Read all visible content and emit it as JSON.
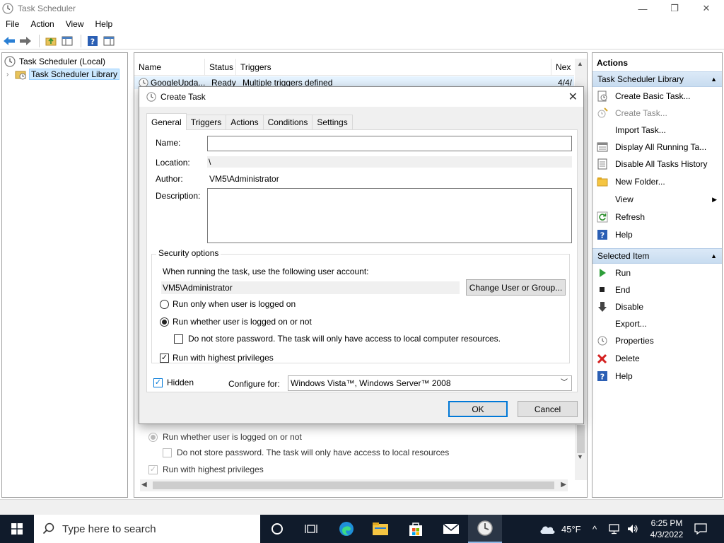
{
  "window": {
    "title": "Task Scheduler",
    "minimize": "—",
    "maximize": "❐",
    "close": "✕"
  },
  "menu": [
    "File",
    "Action",
    "View",
    "Help"
  ],
  "tree": {
    "root": "Task Scheduler (Local)",
    "library": "Task Scheduler Library"
  },
  "list": {
    "columns": [
      "Name",
      "Status",
      "Triggers",
      "Nex"
    ],
    "rows": [
      {
        "name": "GoogleUpda...",
        "status": "Ready",
        "triggers": "Multiple triggers defined",
        "next": "4/4/"
      }
    ]
  },
  "background_props": {
    "run_whether": "Run whether user is logged on or not",
    "no_store": "Do not store password.  The task will only have access to local resources",
    "highest": "Run with highest privileges"
  },
  "actions": {
    "header": "Actions",
    "group1": "Task Scheduler Library",
    "items1": [
      {
        "label": "Create Basic Task...",
        "icon": "create-basic-task-icon"
      },
      {
        "label": "Create Task...",
        "icon": "create-task-icon",
        "disabled": true
      },
      {
        "label": "Import Task...",
        "icon": ""
      },
      {
        "label": "Display All Running Ta...",
        "icon": "running-tasks-icon"
      },
      {
        "label": "Disable All Tasks History",
        "icon": "history-icon"
      },
      {
        "label": "New Folder...",
        "icon": "folder-icon"
      },
      {
        "label": "View",
        "icon": "",
        "submenu": true
      },
      {
        "label": "Refresh",
        "icon": "refresh-icon"
      },
      {
        "label": "Help",
        "icon": "help-icon"
      }
    ],
    "group2": "Selected Item",
    "items2": [
      {
        "label": "Run",
        "icon": "run-icon"
      },
      {
        "label": "End",
        "icon": "end-icon"
      },
      {
        "label": "Disable",
        "icon": "disable-icon"
      },
      {
        "label": "Export...",
        "icon": ""
      },
      {
        "label": "Properties",
        "icon": "properties-icon"
      },
      {
        "label": "Delete",
        "icon": "delete-icon"
      },
      {
        "label": "Help",
        "icon": "help-icon"
      }
    ]
  },
  "dialog": {
    "title": "Create Task",
    "close": "✕",
    "tabs": [
      "General",
      "Triggers",
      "Actions",
      "Conditions",
      "Settings"
    ],
    "name_label": "Name:",
    "name_value": "",
    "location_label": "Location:",
    "location_value": "\\",
    "author_label": "Author:",
    "author_value": "VM5\\Administrator",
    "description_label": "Description:",
    "description_value": "",
    "security_title": "Security options",
    "account_prompt": "When running the task, use the following user account:",
    "account_value": "VM5\\Administrator",
    "change_button": "Change User or Group...",
    "radio_logged_on": "Run only when user is logged on",
    "radio_whether": "Run whether user is logged on or not",
    "no_store_password": "Do not store password.  The task will only have access to local computer resources.",
    "highest_privileges": "Run with highest privileges",
    "hidden": "Hidden",
    "configure_label": "Configure for:",
    "configure_value": "Windows Vista™, Windows Server™ 2008",
    "ok": "OK",
    "cancel": "Cancel"
  },
  "taskbar": {
    "search_placeholder": "Type here to search",
    "temperature": "45°F",
    "time": "6:25 PM",
    "date": "4/3/2022"
  }
}
